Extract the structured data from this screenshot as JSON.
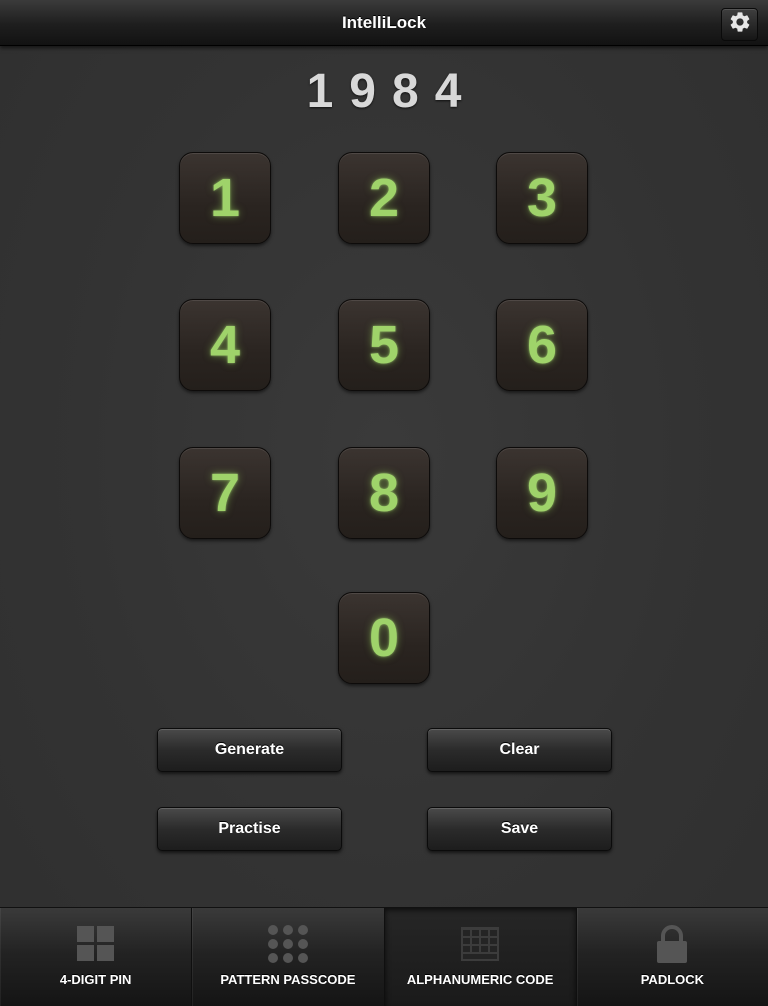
{
  "header": {
    "title": "IntelliLock",
    "settings_icon": "gear-icon"
  },
  "pin_display": {
    "value": "1984"
  },
  "keypad": {
    "keys": [
      "1",
      "2",
      "3",
      "4",
      "5",
      "6",
      "7",
      "8",
      "9",
      "0"
    ],
    "digit_color": "#9fd36a"
  },
  "actions": {
    "generate_label": "Generate",
    "clear_label": "Clear",
    "practise_label": "Practise",
    "save_label": "Save"
  },
  "tab_bar": {
    "selected_index": 2,
    "tabs": [
      {
        "label": "4-DIGIT PIN",
        "icon": "grid-icon"
      },
      {
        "label": "PATTERN PASSCODE",
        "icon": "dots-grid-icon"
      },
      {
        "label": "ALPHANUMERIC CODE",
        "icon": "keyboard-icon"
      },
      {
        "label": "PADLOCK",
        "icon": "padlock-icon"
      }
    ]
  }
}
